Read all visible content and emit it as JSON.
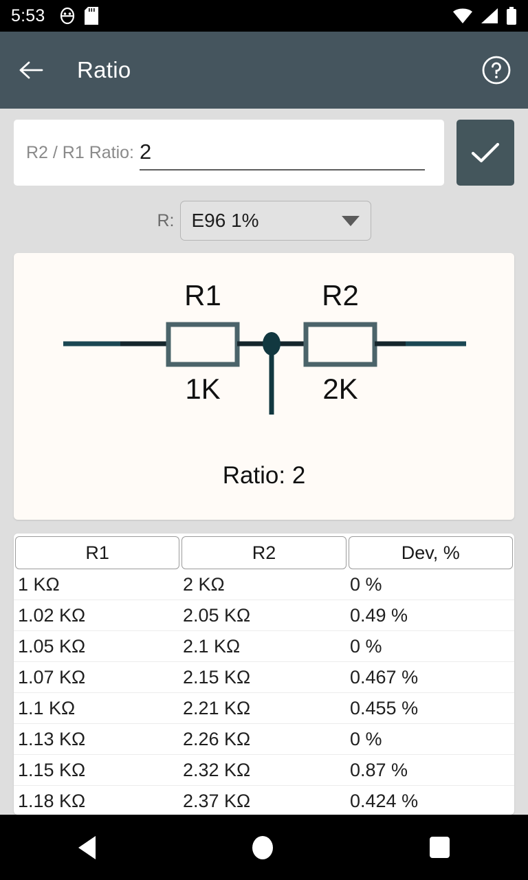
{
  "status_bar": {
    "time": "5:53",
    "left_icons": [
      "android-debug-icon",
      "sd-card-icon"
    ],
    "right_icons": [
      "wifi-icon",
      "cellular-signal-icon",
      "battery-icon"
    ]
  },
  "app_bar": {
    "back_icon": "arrow-back-icon",
    "title": "Ratio",
    "help_icon": "help-circle-icon",
    "background_color": "#45555e"
  },
  "input": {
    "label": "R2 / R1 Ratio:",
    "value": "2",
    "placeholder": "",
    "confirm_icon": "check-icon",
    "confirm_color": "#44565c"
  },
  "series_select": {
    "label": "R:",
    "value": "E96 1%",
    "caret_icon": "chevron-down-icon"
  },
  "diagram": {
    "r1_label": "R1",
    "r1_value": "1K",
    "r2_label": "R2",
    "r2_value": "2K",
    "caption": "Ratio: 2",
    "card_color": "#fffbf7",
    "wire_color": "#15262c",
    "resistor_color": "#4b646a",
    "node_color": "#123840"
  },
  "table": {
    "headers": [
      "R1",
      "R2",
      "Dev, %"
    ],
    "rows": [
      [
        "1 KΩ",
        "2 KΩ",
        "0 %"
      ],
      [
        "1.02 KΩ",
        "2.05 KΩ",
        "0.49 %"
      ],
      [
        "1.05 KΩ",
        "2.1 KΩ",
        "0 %"
      ],
      [
        "1.07 KΩ",
        "2.15 KΩ",
        "0.467 %"
      ],
      [
        "1.1 KΩ",
        "2.21 KΩ",
        "0.455 %"
      ],
      [
        "1.13 KΩ",
        "2.26 KΩ",
        "0 %"
      ],
      [
        "1.15 KΩ",
        "2.32 KΩ",
        "0.87 %"
      ],
      [
        "1.18 KΩ",
        "2.37 KΩ",
        "0.424 %"
      ]
    ]
  },
  "nav_bar": {
    "back_icon": "triangle-back-icon",
    "home_icon": "circle-home-icon",
    "recents_icon": "square-recents-icon"
  }
}
